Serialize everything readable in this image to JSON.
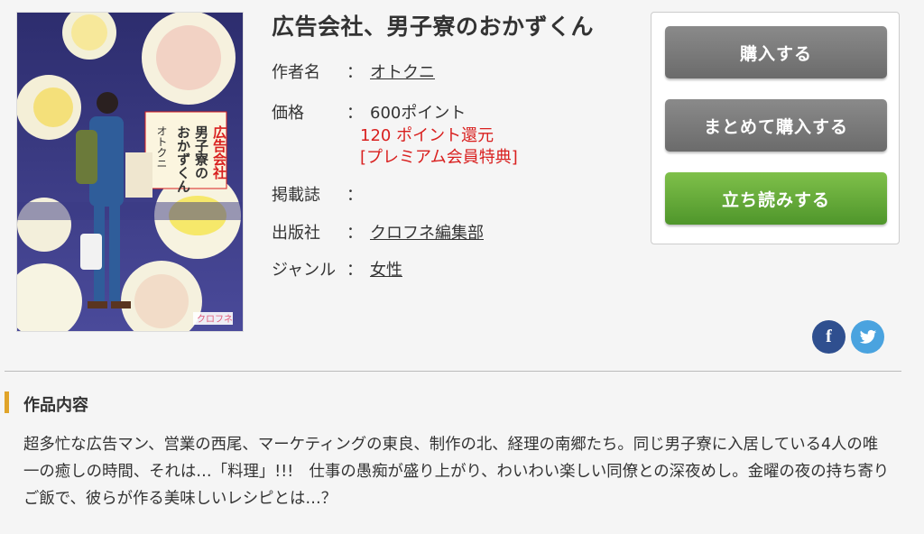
{
  "cover": {
    "title_vertical": "広告会社、男子寮のおかずくん",
    "author": "オトクニ",
    "publisher_mark": "クロフネ"
  },
  "title": "広告会社、男子寮のおかずくん",
  "info": {
    "author_label": "作者名",
    "author": "オトクニ",
    "price_label": "価格",
    "price": "600ポイント",
    "points_back": "120 ポイント還元",
    "premium": "[プレミアム会員特典]",
    "magazine_label": "掲載誌",
    "magazine": "",
    "publisher_label": "出版社",
    "publisher": "クロフネ編集部",
    "genre_label": "ジャンル",
    "genre": "女性",
    "separator": "："
  },
  "buttons": {
    "buy": "購入する",
    "bulk_buy": "まとめて購入する",
    "preview": "立ち読みする"
  },
  "social": {
    "facebook": "f",
    "twitter": "t"
  },
  "section": {
    "title": "作品内容",
    "description": "超多忙な広告マン、営業の西尾、マーケティングの東良、制作の北、経理の南郷たち。同じ男子寮に入居している4人の唯一の癒しの時間、それは…「料理」!!!　仕事の愚痴が盛り上がり、わいわい楽しい同僚との深夜めし。金曜の夜の持ち寄りご飯で、彼らが作る美味しいレシピとは…？"
  },
  "colors": {
    "accent_bar": "#e0a42a",
    "point_red": "#d9201f",
    "button_gray": "#777777",
    "button_green": "#5fa835",
    "facebook": "#2f4f8f",
    "twitter": "#4aa3df"
  }
}
